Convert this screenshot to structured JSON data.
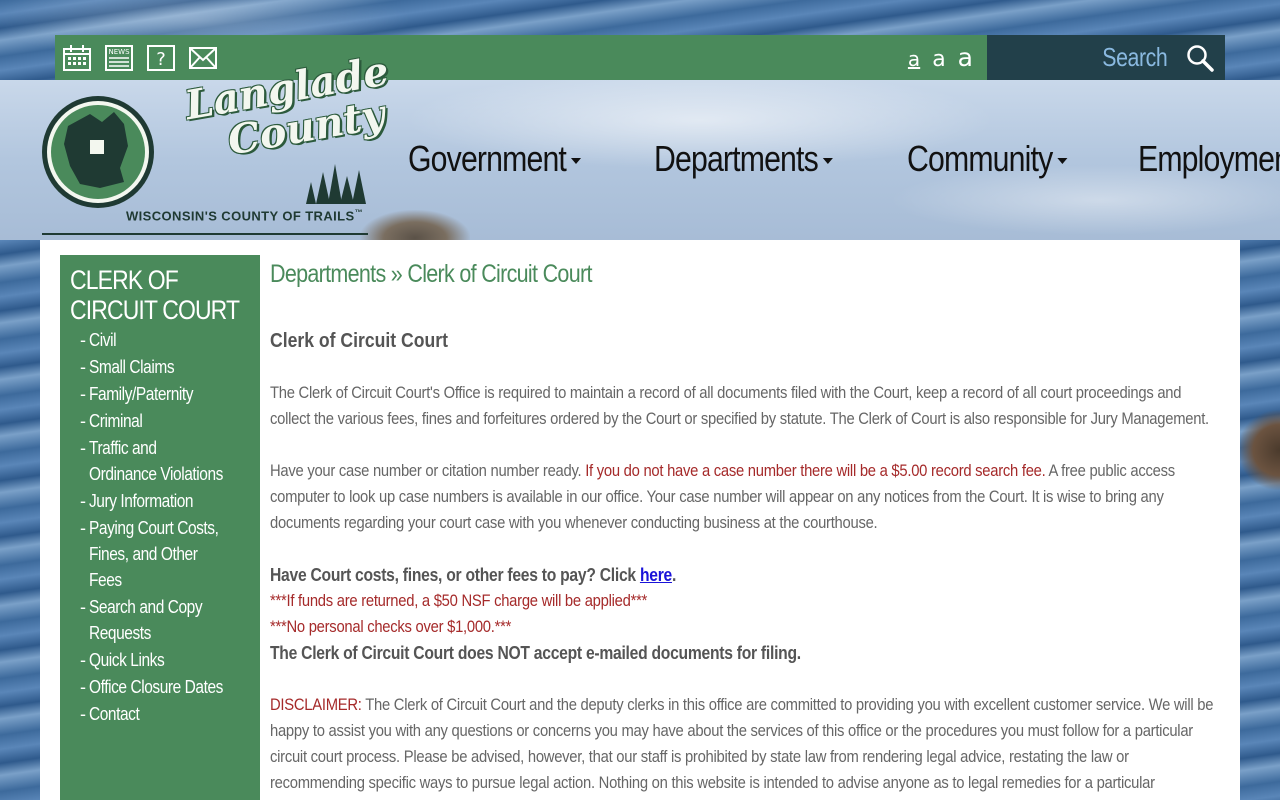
{
  "topbar": {
    "icons": [
      "calendar-icon",
      "news-icon",
      "help-icon",
      "mail-icon"
    ],
    "news_label": "NEWS",
    "help_glyph": "?",
    "font_sizes": [
      "a",
      "a",
      "a"
    ],
    "search_label": "Search"
  },
  "logo": {
    "name_line1": "Langlade",
    "name_line2": "County",
    "tagline": "WISCONSIN'S COUNTY OF TRAILS",
    "trademark": "™"
  },
  "nav": {
    "items": [
      {
        "label": "Government",
        "has_dropdown": true
      },
      {
        "label": "Departments",
        "has_dropdown": true
      },
      {
        "label": "Community",
        "has_dropdown": true
      },
      {
        "label": "Employment",
        "has_dropdown": false
      }
    ]
  },
  "sidebar": {
    "title": "CLERK OF CIRCUIT COURT",
    "items": [
      "Civil",
      "Small Claims",
      "Family/Paternity",
      "Criminal",
      "Traffic and Ordinance Violations",
      "Jury Information",
      "Paying Court Costs, Fines, and Other Fees",
      "Search and Copy Requests",
      "Quick Links",
      "Office Closure Dates",
      "Contact"
    ]
  },
  "main": {
    "breadcrumb": "Departments » Clerk of Circuit Court",
    "title": "Clerk of Circuit Court",
    "para1": "The Clerk of Circuit Court's Office is required to maintain a record of all documents filed with the Court, keep a record of all court proceedings and collect the various fees, fines and forfeitures ordered by the Court or specified by statute.  The Clerk of Court is also responsible for Jury Management.",
    "para2_start": "Have your case number or citation number ready.  ",
    "para2_red": "If you do not have a case number there will be a $5.00 record search fee.",
    "para2_end": " A free public access computer to look up case numbers is available in our office.  Your case number will appear on any notices from the Court.  It is wise to bring any documents regarding your court case with you whenever conducting business at the courthouse.",
    "pay_text": "Have Court costs, fines, or other fees to pay? Click ",
    "pay_link": "here",
    "pay_end": ".",
    "nsf_note": "***If funds are returned, a $50 NSF charge will be applied***",
    "checks_note": "***No personal checks over $1,000.***",
    "no_email": "The Clerk of Circuit Court does NOT accept e-mailed documents for filing.",
    "disclaimer_label": "DISCLAIMER:",
    "disclaimer_text": "  The Clerk of Circuit Court and the deputy clerks in this office are committed to providing you with excellent customer service. We will be happy to assist you with any questions or concerns you may have about the services of this office or the procedures you must follow for a particular circuit court process. Please be advised, however, that our staff is prohibited by state law from rendering legal advice, restating the law or recommending specific ways to pursue legal action. Nothing on this website is intended to advise anyone as to legal remedies for a particular circumstance."
  },
  "colors": {
    "brand_green": "#4a8a5b",
    "search_bg": "#22404a",
    "alert_red": "#a52a2a",
    "link_blue": "#1a13d9"
  }
}
